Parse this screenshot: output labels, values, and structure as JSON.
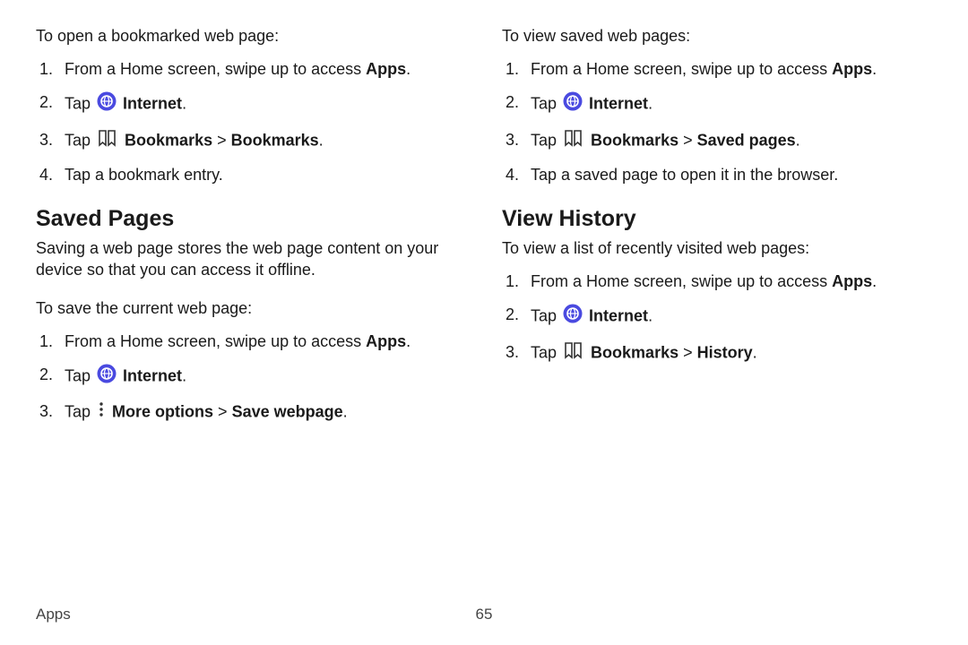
{
  "left": {
    "intro1": "To open a bookmarked web page:",
    "list1": {
      "i1a": "From a Home screen, swipe up to access ",
      "i1b": "Apps",
      "i1c": ".",
      "i2a": "Tap ",
      "i2b": "Internet",
      "i2c": ".",
      "i3a": "Tap ",
      "i3b": "Bookmarks",
      "i3c": " > ",
      "i3d": "Bookmarks",
      "i3e": ".",
      "i4": "Tap a bookmark entry."
    },
    "h2": "Saved Pages",
    "desc": "Saving a web page stores the web page content on your device so that you can access it offline.",
    "intro2": "To save the current web page:",
    "list2": {
      "i1a": "From a Home screen, swipe up to access ",
      "i1b": "Apps",
      "i1c": ".",
      "i2a": "Tap ",
      "i2b": "Internet",
      "i2c": ".",
      "i3a": "Tap ",
      "i3b": "More options",
      "i3c": " > ",
      "i3d": "Save webpage",
      "i3e": "."
    }
  },
  "right": {
    "intro1": "To view saved web pages:",
    "list1": {
      "i1a": "From a Home screen, swipe up to access ",
      "i1b": "Apps",
      "i1c": ".",
      "i2a": "Tap ",
      "i2b": "Internet",
      "i2c": ".",
      "i3a": "Tap ",
      "i3b": "Bookmarks",
      "i3c": " > ",
      "i3d": "Saved pages",
      "i3e": ".",
      "i4": "Tap a saved page to open it in the browser."
    },
    "h2": "View History",
    "desc": "To view a list of recently visited web pages:",
    "list2": {
      "i1a": "From a Home screen, swipe up to access ",
      "i1b": "Apps",
      "i1c": ".",
      "i2a": "Tap ",
      "i2b": "Internet",
      "i2c": ".",
      "i3a": "Tap ",
      "i3b": "Bookmarks",
      "i3c": " > ",
      "i3d": "History",
      "i3e": "."
    }
  },
  "footer": {
    "section": "Apps",
    "page": "65"
  }
}
